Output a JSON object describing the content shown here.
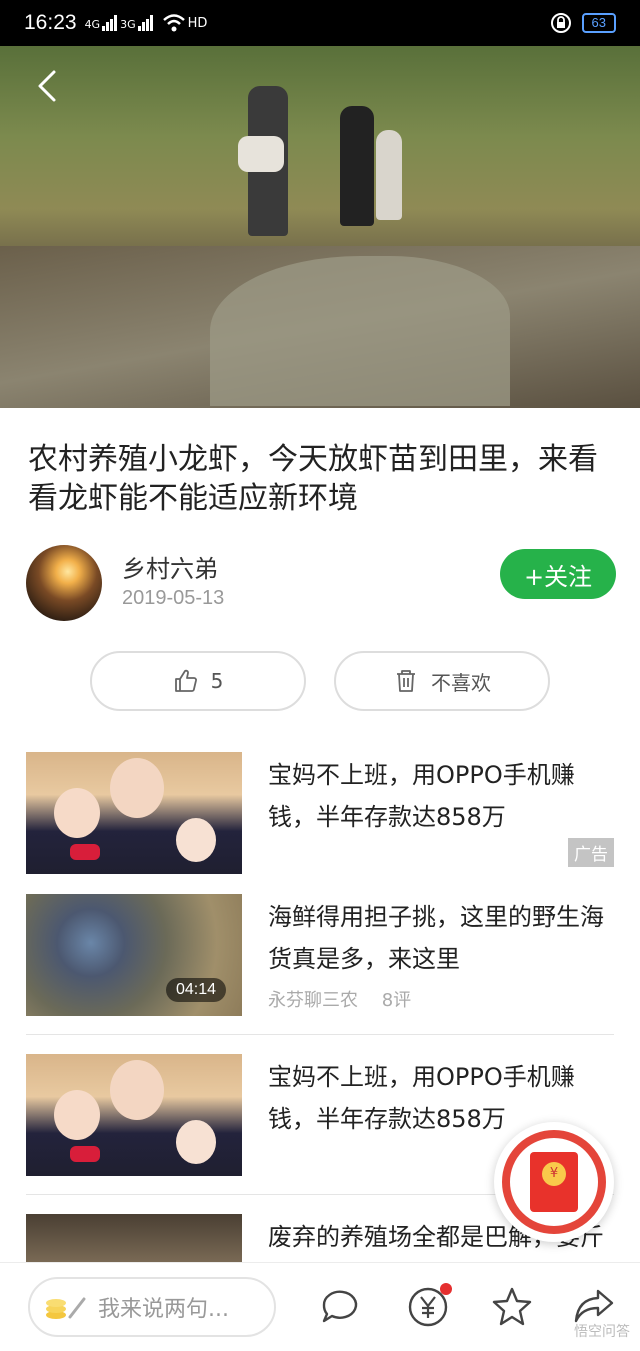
{
  "status_bar": {
    "time": "16:23",
    "network1": "4G",
    "network2": "3G",
    "wifi": "HD",
    "battery": "63"
  },
  "video": {
    "back_icon": "back-arrow-icon"
  },
  "article": {
    "title": "农村养殖小龙虾，今天放虾苗到田里，来看看龙虾能不能适应新环境",
    "author": "乡村六弟",
    "date": "2019-05-13",
    "follow_label": "+关注"
  },
  "reactions": {
    "like_count": "5",
    "dislike_label": "不喜欢"
  },
  "feed": [
    {
      "title": "宝妈不上班，用OPPO手机赚钱，半年存款达858万",
      "badge": "广告"
    },
    {
      "title": "海鲜得用担子挑，这里的野生海货真是多，来这里",
      "source": "永芬聊三农",
      "comments": "8评",
      "duration": "04:14"
    },
    {
      "title": "宝妈不上班，用OPPO手机赚钱，半年存款达858万"
    },
    {
      "title": "废弃的养殖场全都是巴解，要斤一日笛小的一阿"
    }
  ],
  "bottom_bar": {
    "comment_placeholder": "我来说两句...",
    "watermark": "悟空问答"
  },
  "colors": {
    "accent_green": "#26b24a",
    "red": "#e4453a"
  }
}
